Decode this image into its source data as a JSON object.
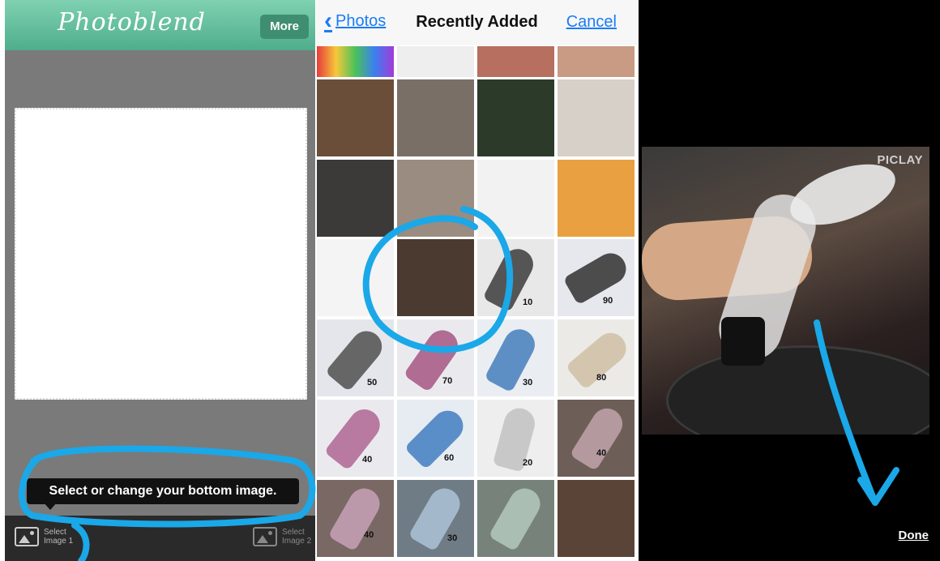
{
  "left": {
    "app_title": "Photoblend",
    "more_label": "More",
    "tooltip": "Select or change your bottom image.",
    "select1_label_line1": "Select",
    "select1_label_line2": "Image 1",
    "select2_label_line1": "Select",
    "select2_label_line2": "Image 2"
  },
  "mid": {
    "back_label": "Photos",
    "title": "Recently Added",
    "cancel_label": "Cancel",
    "cell_labels": [
      "10",
      "90",
      "50",
      "70",
      "30",
      "80",
      "40",
      "60",
      "20",
      "40",
      "40",
      "30"
    ]
  },
  "right": {
    "watermark": "PICLAY",
    "done_label": "Done"
  },
  "colors": {
    "header_green": "#5fbf9c",
    "link_blue": "#1a7cf5",
    "annotation_blue": "#1aa8e8"
  }
}
